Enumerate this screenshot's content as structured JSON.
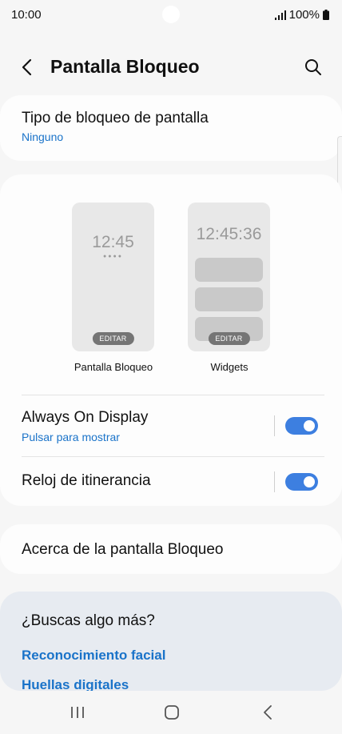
{
  "status_bar": {
    "time": "10:00",
    "battery": "100%",
    "icons": [
      "signal-icon",
      "battery-icon"
    ]
  },
  "header": {
    "title": "Pantalla Bloqueo",
    "back_icon": "back-arrow-icon",
    "search_icon": "search-icon"
  },
  "lock_type": {
    "title": "Tipo de bloqueo de pantalla",
    "value": "Ninguno"
  },
  "previews": {
    "lock": {
      "clock": "12:45",
      "dots": "●●●●",
      "edit_label": "EDITAR",
      "label": "Pantalla Bloqueo"
    },
    "widgets": {
      "clock": "12:45:36",
      "edit_label": "EDITAR",
      "label": "Widgets"
    }
  },
  "settings": {
    "always_on_display": {
      "title": "Always On Display",
      "subtitle": "Pulsar para mostrar",
      "enabled": true
    },
    "roaming_clock": {
      "title": "Reloj de itinerancia",
      "enabled": true
    }
  },
  "about": {
    "title": "Acerca de la pantalla Bloqueo"
  },
  "more": {
    "heading": "¿Buscas algo más?",
    "links": [
      "Reconocimiento facial",
      "Huellas digitales"
    ]
  },
  "colors": {
    "accent": "#1a73c9",
    "toggle_on": "#3d7fe0",
    "background": "#f6f6f6",
    "suggestion_card": "#e7ebf1"
  },
  "nav_bar": {
    "icons": [
      "recent-apps-icon",
      "home-icon",
      "back-icon"
    ]
  }
}
